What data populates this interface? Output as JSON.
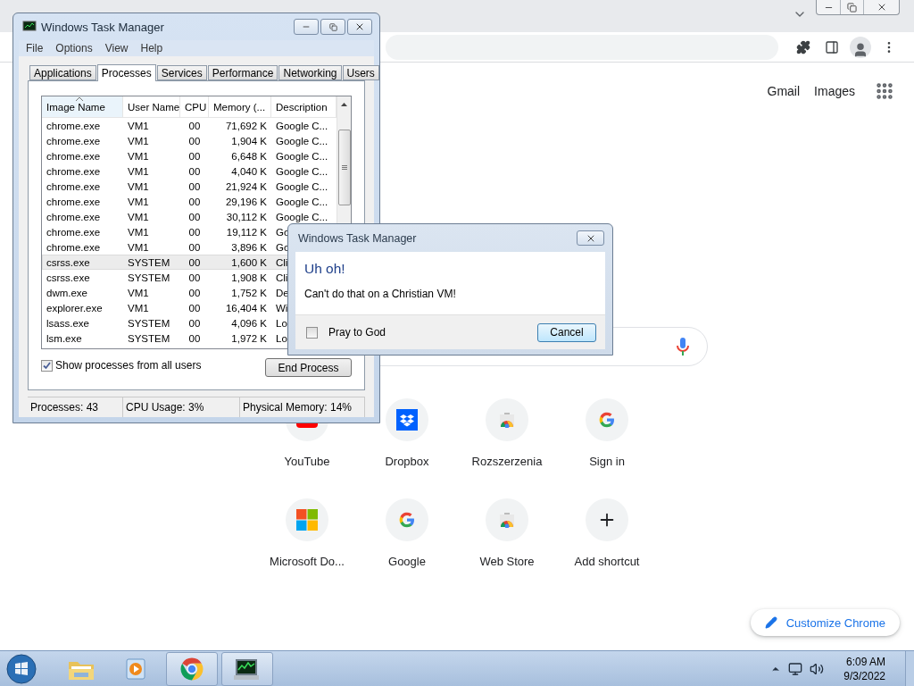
{
  "browser": {
    "header_links": [
      "Gmail",
      "Images"
    ],
    "shortcuts": [
      {
        "label": "YouTube",
        "kind": "youtube"
      },
      {
        "label": "Dropbox",
        "kind": "dropbox"
      },
      {
        "label": "Rozszerzenia",
        "kind": "webstore"
      },
      {
        "label": "Sign in",
        "kind": "google"
      },
      {
        "label": "Microsoft Do...",
        "kind": "microsoft"
      },
      {
        "label": "Google",
        "kind": "google"
      },
      {
        "label": "Web Store",
        "kind": "webstore"
      },
      {
        "label": "Add shortcut",
        "kind": "add"
      }
    ],
    "customize_button": "Customize Chrome"
  },
  "task_manager": {
    "title": "Windows Task Manager",
    "menu": [
      "File",
      "Options",
      "View",
      "Help"
    ],
    "tabs": [
      {
        "label": "Applications",
        "selected": false
      },
      {
        "label": "Processes",
        "selected": true
      },
      {
        "label": "Services",
        "selected": false
      },
      {
        "label": "Performance",
        "selected": false
      },
      {
        "label": "Networking",
        "selected": false
      },
      {
        "label": "Users",
        "selected": false
      }
    ],
    "columns": [
      "Image Name",
      "User Name",
      "CPU",
      "Memory (...",
      "Description"
    ],
    "rows": [
      {
        "cells": [
          "chrome.exe",
          "VM1",
          "00",
          "71,692 K",
          "Google C..."
        ],
        "selected": false
      },
      {
        "cells": [
          "chrome.exe",
          "VM1",
          "00",
          "1,904 K",
          "Google C..."
        ],
        "selected": false
      },
      {
        "cells": [
          "chrome.exe",
          "VM1",
          "00",
          "6,648 K",
          "Google C..."
        ],
        "selected": false
      },
      {
        "cells": [
          "chrome.exe",
          "VM1",
          "00",
          "4,040 K",
          "Google C..."
        ],
        "selected": false
      },
      {
        "cells": [
          "chrome.exe",
          "VM1",
          "00",
          "21,924 K",
          "Google C..."
        ],
        "selected": false
      },
      {
        "cells": [
          "chrome.exe",
          "VM1",
          "00",
          "29,196 K",
          "Google C..."
        ],
        "selected": false
      },
      {
        "cells": [
          "chrome.exe",
          "VM1",
          "00",
          "30,112 K",
          "Google C..."
        ],
        "selected": false
      },
      {
        "cells": [
          "chrome.exe",
          "VM1",
          "00",
          "19,112 K",
          "Go"
        ],
        "selected": false
      },
      {
        "cells": [
          "chrome.exe",
          "VM1",
          "00",
          "3,896 K",
          "Go"
        ],
        "selected": false
      },
      {
        "cells": [
          "csrss.exe",
          "SYSTEM",
          "00",
          "1,600 K",
          "Cli"
        ],
        "selected": true
      },
      {
        "cells": [
          "csrss.exe",
          "SYSTEM",
          "00",
          "1,908 K",
          "Cli"
        ],
        "selected": false
      },
      {
        "cells": [
          "dwm.exe",
          "VM1",
          "00",
          "1,752 K",
          "De"
        ],
        "selected": false
      },
      {
        "cells": [
          "explorer.exe",
          "VM1",
          "00",
          "16,404 K",
          "Wi"
        ],
        "selected": false
      },
      {
        "cells": [
          "lsass.exe",
          "SYSTEM",
          "00",
          "4,096 K",
          "Lo"
        ],
        "selected": false
      },
      {
        "cells": [
          "lsm.exe",
          "SYSTEM",
          "00",
          "1,972 K",
          "Lo"
        ],
        "selected": false
      }
    ],
    "show_all": {
      "label": "Show processes from all users",
      "checked": true
    },
    "end_button": "End Process",
    "status": [
      "Processes: 43",
      "CPU Usage: 3%",
      "Physical Memory: 14%"
    ]
  },
  "dialog": {
    "title": "Windows Task Manager",
    "heading": "Uh oh!",
    "message": "Can't do that on a Christian VM!",
    "checkbox": {
      "label": "Pray to God",
      "checked": false
    },
    "button": "Cancel"
  },
  "taskbar": {
    "apps": [
      {
        "kind": "explorer"
      },
      {
        "kind": "media"
      },
      {
        "kind": "chrome"
      },
      {
        "kind": "taskmgr"
      }
    ],
    "time": "6:09 AM",
    "date": "9/3/2022"
  }
}
